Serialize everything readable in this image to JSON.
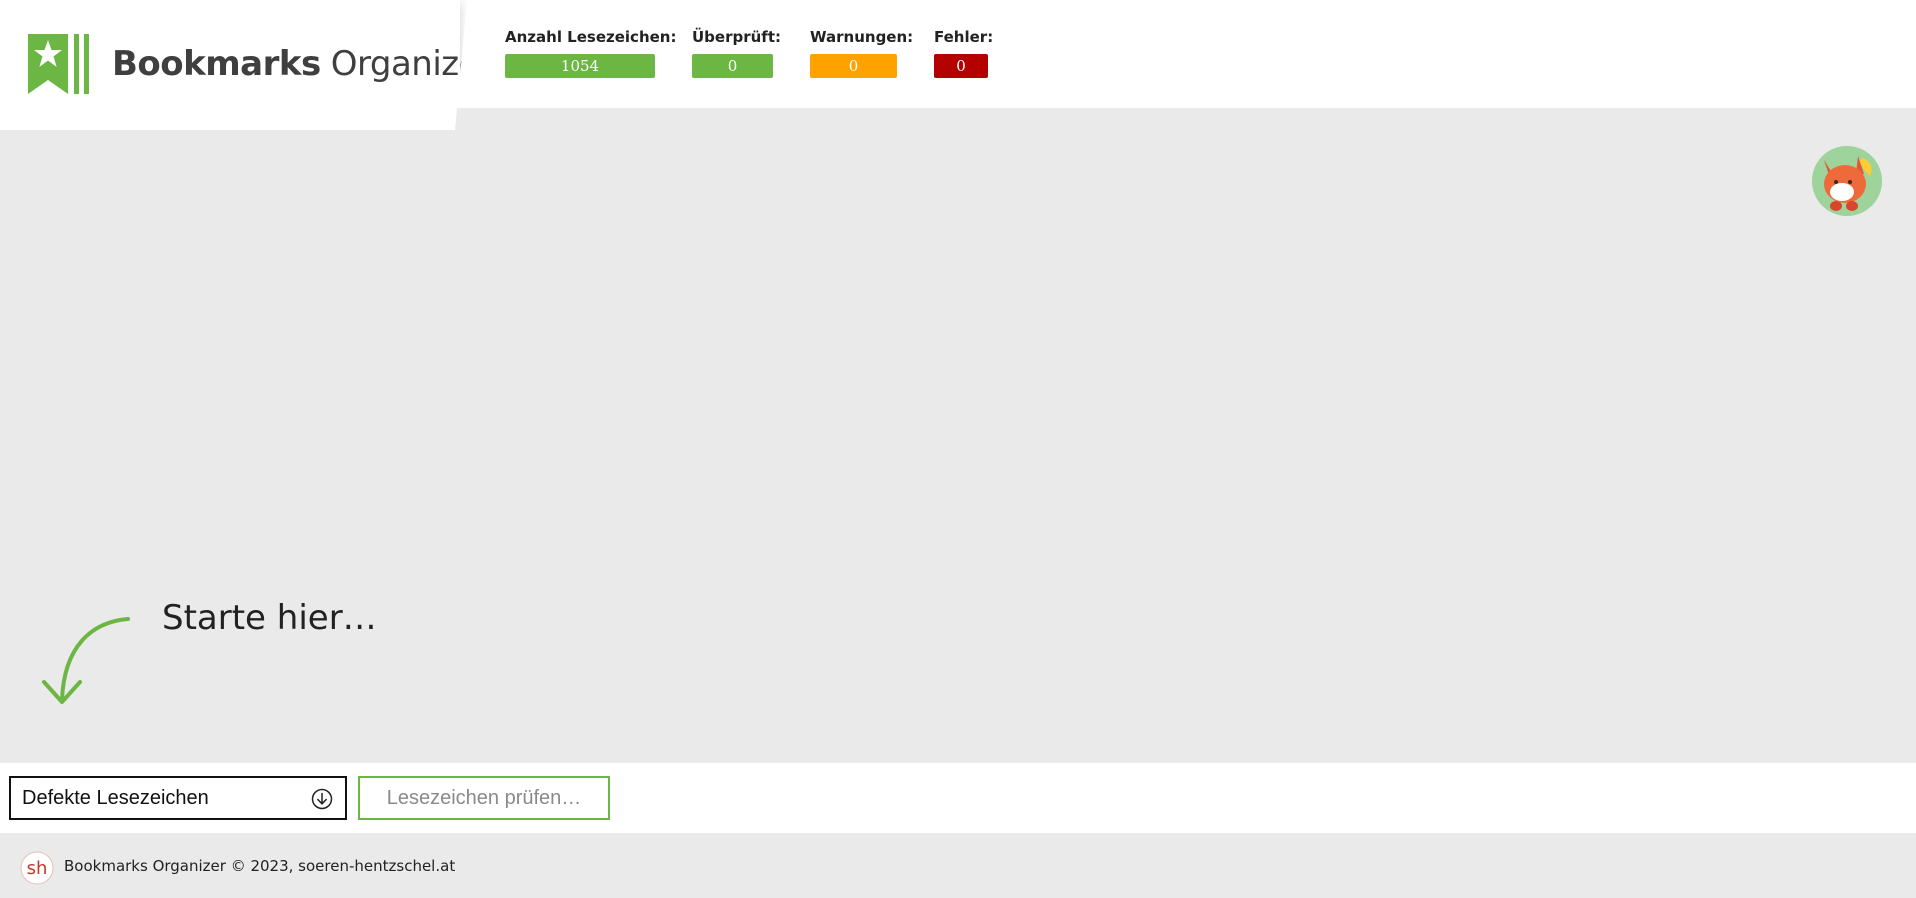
{
  "app": {
    "name_bold": "Bookmarks",
    "name_light": "Organizer"
  },
  "stats": {
    "total": {
      "label": "Anzahl Lesezeichen:",
      "value": "1054",
      "color": "#6cb644"
    },
    "checked": {
      "label": "Überprüft:",
      "value": "0",
      "color": "#6cb644"
    },
    "warnings": {
      "label": "Warnungen:",
      "value": "0",
      "color": "#ffa200"
    },
    "errors": {
      "label": "Fehler:",
      "value": "0",
      "color": "#b30000"
    }
  },
  "hint": {
    "text": "Starte hier…",
    "icon": "curved-arrow-down-icon"
  },
  "actions": {
    "filter_value": "Defekte Lesezeichen",
    "filter_icon": "circle-arrow-down-icon",
    "check_label": "Lesezeichen prüfen…"
  },
  "footer": {
    "logo_text": "sh",
    "text": "Bookmarks Organizer © 2023, soeren-hentzschel.at"
  },
  "colors": {
    "accent_green": "#6cb644",
    "warning_orange": "#ffa200",
    "error_red": "#b30000",
    "background": "#eaeaea"
  }
}
